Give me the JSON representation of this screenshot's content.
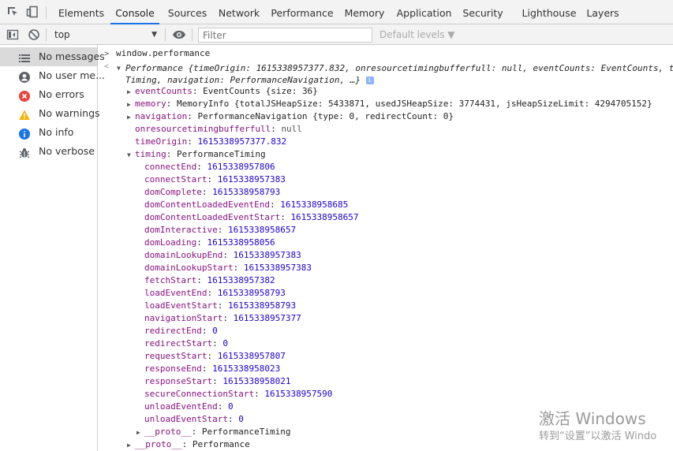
{
  "tabs": [
    "Elements",
    "Console",
    "Sources",
    "Network",
    "Performance",
    "Memory",
    "Application",
    "Security",
    "Lighthouse",
    "Layers"
  ],
  "toolbar": {
    "context": "top",
    "filter_placeholder": "Filter",
    "levels": "Default levels ▼"
  },
  "sidebar": [
    {
      "label": "No messages",
      "icon": "list-icon"
    },
    {
      "label": "No user me...",
      "icon": "user-icon"
    },
    {
      "label": "No errors",
      "icon": "error-icon"
    },
    {
      "label": "No warnings",
      "icon": "warning-icon"
    },
    {
      "label": "No info",
      "icon": "info-icon"
    },
    {
      "label": "No verbose",
      "icon": "bug-icon"
    }
  ],
  "console": {
    "input": "window.performance",
    "summary_line1": "Performance {timeOrigin: 1615338957377.832, onresourcetimingbufferfull: null, eventCounts: EventCounts, t",
    "summary_line2": "Timing, navigation: PerformanceNavigation, …}",
    "eventCounts": {
      "key": "eventCounts",
      "value": "EventCounts {size: 36}"
    },
    "memory": {
      "key": "memory",
      "value": "MemoryInfo {totalJSHeapSize: 5433871, usedJSHeapSize: 3774431, jsHeapSizeLimit: 4294705152}"
    },
    "navigation": {
      "key": "navigation",
      "value": "PerformanceNavigation {type: 0, redirectCount: 0}"
    },
    "onresource": {
      "key": "onresourcetimingbufferfull",
      "value": "null"
    },
    "timeOrigin": {
      "key": "timeOrigin",
      "value": "1615338957377.832"
    },
    "timing": {
      "key": "timing",
      "value": "PerformanceTiming"
    },
    "timing_entries": [
      {
        "k": "connectEnd",
        "v": "1615338957806"
      },
      {
        "k": "connectStart",
        "v": "1615338957383"
      },
      {
        "k": "domComplete",
        "v": "1615338958793"
      },
      {
        "k": "domContentLoadedEventEnd",
        "v": "1615338958685"
      },
      {
        "k": "domContentLoadedEventStart",
        "v": "1615338958657"
      },
      {
        "k": "domInteractive",
        "v": "1615338958657"
      },
      {
        "k": "domLoading",
        "v": "1615338958056"
      },
      {
        "k": "domainLookupEnd",
        "v": "1615338957383"
      },
      {
        "k": "domainLookupStart",
        "v": "1615338957383"
      },
      {
        "k": "fetchStart",
        "v": "1615338957382"
      },
      {
        "k": "loadEventEnd",
        "v": "1615338958793"
      },
      {
        "k": "loadEventStart",
        "v": "1615338958793"
      },
      {
        "k": "navigationStart",
        "v": "1615338957377"
      },
      {
        "k": "redirectEnd",
        "v": "0"
      },
      {
        "k": "redirectStart",
        "v": "0"
      },
      {
        "k": "requestStart",
        "v": "1615338957807"
      },
      {
        "k": "responseEnd",
        "v": "1615338958023"
      },
      {
        "k": "responseStart",
        "v": "1615338958021"
      },
      {
        "k": "secureConnectionStart",
        "v": "1615338957590"
      },
      {
        "k": "unloadEventEnd",
        "v": "0"
      },
      {
        "k": "unloadEventStart",
        "v": "0"
      }
    ],
    "proto_timing": {
      "key": "__proto__",
      "value": "PerformanceTiming"
    },
    "proto_perf": {
      "key": "__proto__",
      "value": "Performance"
    }
  },
  "watermark": {
    "line1": "激活 Windows",
    "line2": "转到“设置”以激活 Windo"
  },
  "colors": {
    "accent": "#1a73e8",
    "key": "#881280",
    "number": "#1c00cf"
  }
}
